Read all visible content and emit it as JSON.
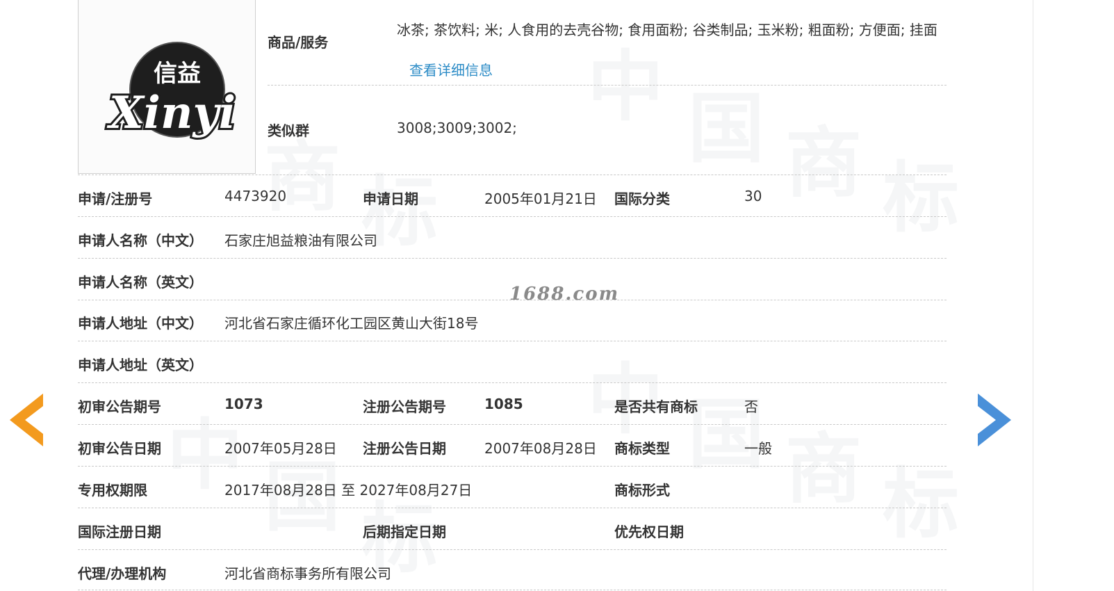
{
  "logo": {
    "text_cn": "信益",
    "text_en": "Xinyi"
  },
  "goods": {
    "label": "商品/服务",
    "value": "冰茶; 茶饮料; 米; 人食用的去壳谷物; 食用面粉; 谷类制品; 玉米粉; 粗面粉; 方便面; 挂面",
    "detail_link": "查看详细信息"
  },
  "similar_group": {
    "label": "类似群",
    "value": "3008;3009;3002;"
  },
  "rows": {
    "reg_no": {
      "label": "申请/注册号",
      "value": "4473920"
    },
    "app_date": {
      "label": "申请日期",
      "value": "2005年01月21日"
    },
    "intl_class": {
      "label": "国际分类",
      "value": "30"
    },
    "applicant_cn": {
      "label": "申请人名称（中文）",
      "value": "石家庄旭益粮油有限公司"
    },
    "applicant_en": {
      "label": "申请人名称（英文）",
      "value": ""
    },
    "address_cn": {
      "label": "申请人地址（中文）",
      "value": "河北省石家庄循环化工园区黄山大街18号"
    },
    "address_en": {
      "label": "申请人地址（英文）",
      "value": ""
    },
    "prelim_no": {
      "label": "初审公告期号",
      "value": "1073"
    },
    "reg_pub_no": {
      "label": "注册公告期号",
      "value": "1085"
    },
    "shared": {
      "label": "是否共有商标",
      "value": "否"
    },
    "prelim_date": {
      "label": "初审公告日期",
      "value": "2007年05月28日"
    },
    "reg_pub_date": {
      "label": "注册公告日期",
      "value": "2007年08月28日"
    },
    "tm_type": {
      "label": "商标类型",
      "value": "一般"
    },
    "exclusive": {
      "label": "专用权期限",
      "value": "2017年08月28日 至 2027年08月27日"
    },
    "tm_form": {
      "label": "商标形式",
      "value": ""
    },
    "intl_reg_date": {
      "label": "国际注册日期",
      "value": ""
    },
    "later_date": {
      "label": "后期指定日期",
      "value": ""
    },
    "priority_date": {
      "label": "优先权日期",
      "value": ""
    },
    "agent": {
      "label": "代理/办理机构",
      "value": "河北省商标事务所有限公司"
    }
  },
  "watermark": {
    "site": "1688.com",
    "chars": [
      "中",
      "国",
      "商",
      "标",
      "商",
      "标",
      "中",
      "国",
      "商",
      "标",
      "中",
      "国",
      "标"
    ]
  },
  "nav": {
    "prev_icon": "arrow-left-icon",
    "next_icon": "arrow-right-icon",
    "prev_color": "#f39a1e",
    "next_color": "#4a90d9"
  }
}
